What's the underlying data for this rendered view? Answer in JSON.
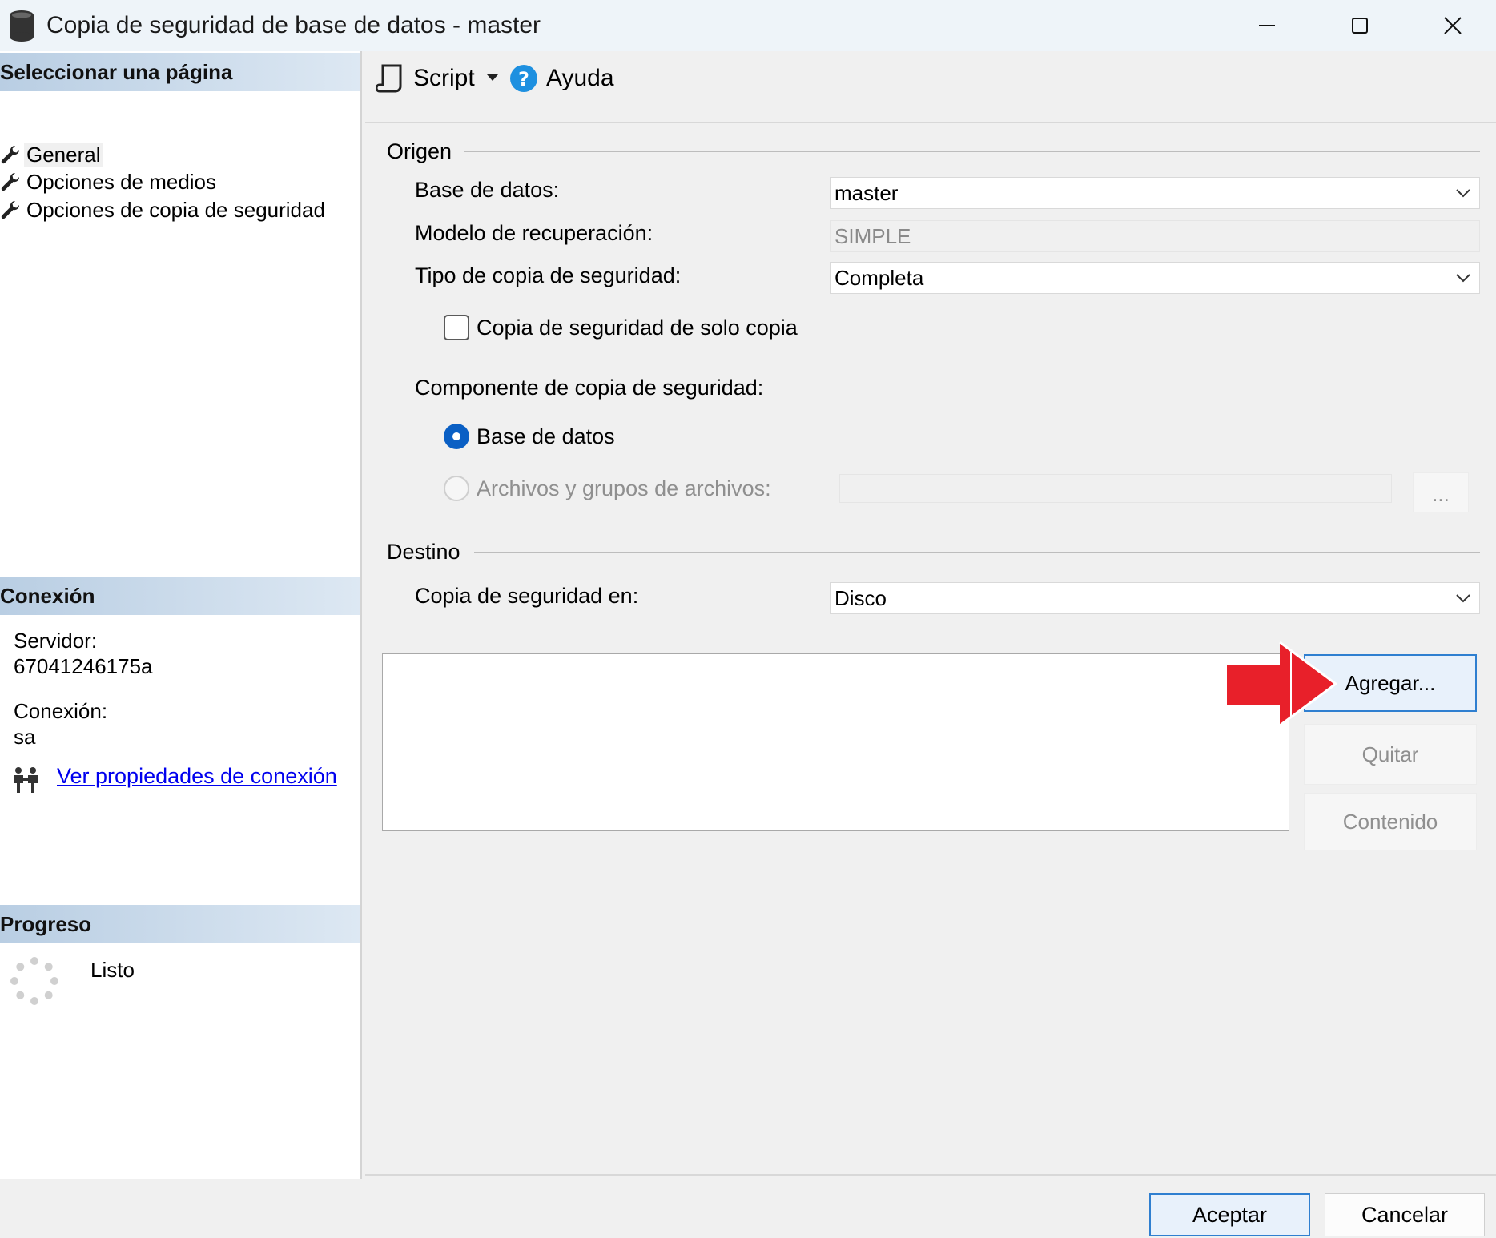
{
  "window": {
    "title": "Copia de seguridad de base de datos - master"
  },
  "left": {
    "select_page_header": "Seleccionar una página",
    "pages": [
      {
        "label": "General",
        "selected": true
      },
      {
        "label": "Opciones de medios",
        "selected": false
      },
      {
        "label": "Opciones de copia de seguridad",
        "selected": false
      }
    ],
    "connection_header": "Conexión",
    "server_label": "Servidor:",
    "server_value": "67041246175a",
    "connection_label": "Conexión:",
    "connection_value": "sa",
    "connection_link": "Ver propiedades de conexión",
    "progress_header": "Progreso",
    "progress_status": "Listo"
  },
  "toolbar": {
    "script_label": "Script",
    "help_label": "Ayuda"
  },
  "source": {
    "group_title": "Origen",
    "database_label": "Base de datos:",
    "database_value": "master",
    "recovery_label": "Modelo de recuperación:",
    "recovery_value": "SIMPLE",
    "backup_type_label": "Tipo de copia de seguridad:",
    "backup_type_value": "Completa",
    "copy_only_label": "Copia de seguridad de solo copia",
    "copy_only_checked": false,
    "component_label": "Componente de copia de seguridad:",
    "component_database_label": "Base de datos",
    "component_files_label": "Archivos y grupos de archivos:",
    "browse_label": "..."
  },
  "destination": {
    "group_title": "Destino",
    "backup_to_label": "Copia de seguridad en:",
    "backup_to_value": "Disco",
    "add_label": "Agregar...",
    "remove_label": "Quitar",
    "contents_label": "Contenido"
  },
  "footer": {
    "ok_label": "Aceptar",
    "cancel_label": "Cancelar"
  },
  "colors": {
    "accent": "#0a5fc4",
    "link": "#0000ee",
    "annotation_arrow": "#e8202a"
  }
}
